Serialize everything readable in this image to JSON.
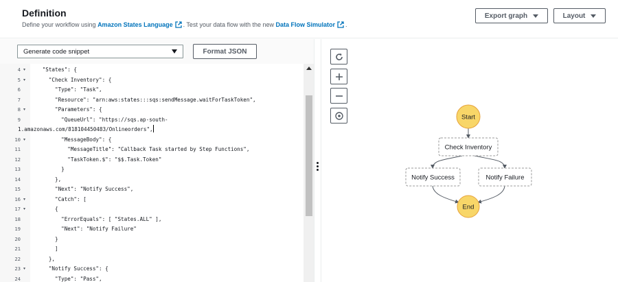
{
  "header": {
    "title": "Definition",
    "subtitle_pre": "Define your workflow using ",
    "link_asl": "Amazon States Language",
    "subtitle_mid": ". Test your data flow with the new ",
    "link_simulator": "Data Flow Simulator",
    "subtitle_end": ".",
    "export_label": "Export graph",
    "layout_label": "Layout"
  },
  "toolbar": {
    "snippet_label": "Generate code snippet",
    "format_label": "Format JSON"
  },
  "code_lines": [
    {
      "n": "4",
      "fold": true,
      "text": "   \"States\": {"
    },
    {
      "n": "5",
      "fold": true,
      "text": "     \"Check Inventory\": {"
    },
    {
      "n": "6",
      "fold": false,
      "text": "       \"Type\": \"Task\","
    },
    {
      "n": "7",
      "fold": false,
      "text": "       \"Resource\": \"arn:aws:states:::sqs:sendMessage.waitForTaskToken\","
    },
    {
      "n": "8",
      "fold": true,
      "text": "       \"Parameters\": {"
    },
    {
      "n": "9",
      "fold": false,
      "text": "         \"QueueUrl\": \"https://sqs.ap-south-"
    },
    {
      "n": "",
      "fold": false,
      "text": "1.amazonaws.com/818104450483/Onlineorders\",",
      "cursor": true
    },
    {
      "n": "10",
      "fold": true,
      "text": "         \"MessageBody\": {"
    },
    {
      "n": "11",
      "fold": false,
      "text": "           \"MessageTitle\": \"Callback Task started by Step Functions\","
    },
    {
      "n": "12",
      "fold": false,
      "text": "           \"TaskToken.$\": \"$$.Task.Token\""
    },
    {
      "n": "13",
      "fold": false,
      "text": "         }"
    },
    {
      "n": "14",
      "fold": false,
      "text": "       },"
    },
    {
      "n": "15",
      "fold": false,
      "text": "       \"Next\": \"Notify Success\","
    },
    {
      "n": "16",
      "fold": true,
      "text": "       \"Catch\": ["
    },
    {
      "n": "17",
      "fold": true,
      "text": "       {"
    },
    {
      "n": "18",
      "fold": false,
      "text": "         \"ErrorEquals\": [ \"States.ALL\" ],"
    },
    {
      "n": "19",
      "fold": false,
      "text": "         \"Next\": \"Notify Failure\""
    },
    {
      "n": "20",
      "fold": false,
      "text": "       }"
    },
    {
      "n": "21",
      "fold": false,
      "text": "       ]"
    },
    {
      "n": "22",
      "fold": false,
      "text": "     },"
    },
    {
      "n": "23",
      "fold": true,
      "text": "     \"Notify Success\": {"
    },
    {
      "n": "24",
      "fold": false,
      "text": "       \"Type\": \"Pass\","
    }
  ],
  "graph": {
    "start": "Start",
    "check_inventory": "Check Inventory",
    "notify_success": "Notify Success",
    "notify_failure": "Notify Failure",
    "end": "End",
    "colors": {
      "terminal": "#f8d668",
      "terminal_border": "#e6a23c",
      "edge": "#545b64",
      "node_border": "#999999"
    }
  },
  "icons": [
    "external-link-icon",
    "refresh-icon",
    "zoom-in-icon",
    "zoom-out-icon",
    "center-icon",
    "drag-handle-icon"
  ]
}
